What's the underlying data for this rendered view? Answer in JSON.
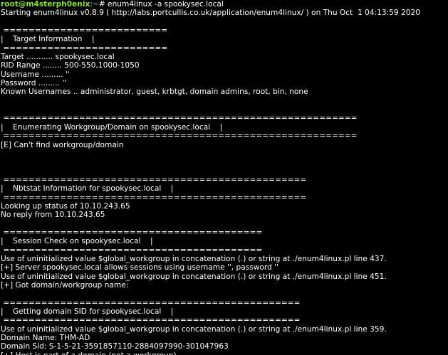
{
  "prompt": {
    "user_host": "root@m4sterph0enix",
    "colon": ":",
    "path": "~",
    "symbol": "# ",
    "command": "enum4linux -a spookysec.local"
  },
  "colors": {
    "background": "#000000",
    "text": "#ffffff",
    "prompt_user": "#8ae234",
    "prompt_path": "#729fcf"
  },
  "output_lines": [
    "Starting enum4linux v0.8.9 ( http://labs.portcullis.co.uk/application/enum4linux/ ) on Thu Oct  1 04:13:59 2020",
    "",
    " ==========================",
    "|    Target Information    |",
    " ==========================",
    "Target ........... spookysec.local",
    "RID Range ........ 500-550,1000-1050",
    "Username ......... ''",
    "Password ......... ''",
    "Known Usernames .. administrator, guest, krbtgt, domain admins, root, bin, none",
    "",
    "",
    " ========================================================",
    "|    Enumerating Workgroup/Domain on spookysec.local    |",
    " ========================================================",
    "[E] Can't find workgroup/domain",
    "",
    "",
    "",
    " ================================================",
    "|    Nbtstat Information for spookysec.local    |",
    " ================================================",
    "Looking up status of 10.10.243.65",
    "No reply from 10.10.243.65",
    "",
    " =========================================",
    "|    Session Check on spookysec.local    |",
    " =========================================",
    "Use of uninitialized value $global_workgroup in concatenation (.) or string at ./enum4linux.pl line 437.",
    "[+] Server spookysec.local allows sessions using username '', password ''",
    "Use of uninitialized value $global_workgroup in concatenation (.) or string at ./enum4linux.pl line 451.",
    "[+] Got domain/workgroup name:",
    "",
    " ===============================================",
    "|    Getting domain SID for spookysec.local    |",
    " ===============================================",
    "Use of uninitialized value $global_workgroup in concatenation (.) or string at ./enum4linux.pl line 359.",
    "Domain Name: THM-AD",
    "Domain Sid: S-1-5-21-3591857110-2884097990-301047963",
    "[+] Host is part of a domain (not a workgroup)"
  ]
}
